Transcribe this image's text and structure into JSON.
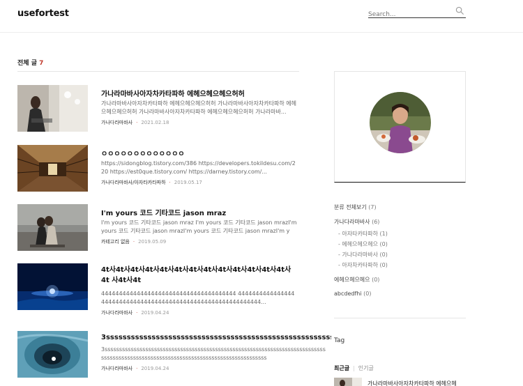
{
  "header": {
    "logo": "usefortest",
    "search_placeholder": "Search..."
  },
  "listing": {
    "label": "전체 글",
    "count": "7"
  },
  "posts": [
    {
      "title": "가나라마바사아자차카타파하 에헤으헤으헤으허허",
      "excerpt": "가나라마바사아자차카타파하 에헤으헤으헤으허허 가나라마바사아자차카타파하 에헤으헤으헤으허허 가나라마바사아자차카타파하 에헤으헤으헤으허허 가나라마바...",
      "category": "가나다라마바사",
      "date": "2021.02.18"
    },
    {
      "title": "ㅇㅇㅇㅇㅇㅇㅇㅇㅇㅇㅇㅇㅇ",
      "excerpt": "https://sidongblog.tistory.com/386 https://developers.tokildesu.com/220 https://est0que.tistory.com/ https://darney.tistory.com/...",
      "category": "가나다라마바사/아자타카타파하",
      "date": "2019.05.17"
    },
    {
      "title": "I'm yours 코드 기타코드 jason mraz",
      "excerpt": "I'm yours 코드 기타코드 jason mraz I'm yours 코드 기타코드 jason mrazI'm yours 코드 기타코드 jason mrazI'm yours 코드 기타코드 jason mrazI'm yo...",
      "category": "카테고리 없음",
      "date": "2019.05.09"
    },
    {
      "title": "4t사4t사4t사4t사4t사4t사4t사4t사4t사4t사4t사4t사4t사4t 사4t사4t",
      "excerpt": "44444444444444444444444444444444444444 4444444444444444444444444444444444444444444444444444444444444...",
      "category": "가나다라마바사",
      "date": "2019.04.24"
    },
    {
      "title": "3ssssssssssssssssssssssssssssssssssssssssssssssssssssssssssssss",
      "excerpt": "3sssssssssssssssssssssssssssssssssssssssssssssssssssssssssssssssssssssssssssssssssssssssssssssssssssssssssssssssssssssssssssssssssssss",
      "category": "가나다라마바사",
      "date": "2019.04.24"
    }
  ],
  "sidebar": {
    "categories": [
      {
        "label": "분류 전체보기",
        "count": "(7)",
        "sub": false
      },
      {
        "label": "가나다라마바사",
        "count": "(6)",
        "sub": false
      },
      {
        "label": "- 아자타카타파하",
        "count": "(1)",
        "sub": true
      },
      {
        "label": "- 에헤으헤으헤으",
        "count": "(0)",
        "sub": true
      },
      {
        "label": "- 가나다라마바사",
        "count": "(0)",
        "sub": true
      },
      {
        "label": "- 아자차카타파하",
        "count": "(0)",
        "sub": true
      },
      {
        "label": "에헤으헤으헤으",
        "count": "(0)",
        "sub": false
      },
      {
        "label": "abcdedfhi",
        "count": "(0)",
        "sub": false
      }
    ],
    "tag_title": "Tag",
    "tab_recent": "최근글",
    "tab_popular": "인기글",
    "recent_title": "가나라마바사아자차카타파하 에헤으헤"
  },
  "colors": {
    "accent": "#c0392b"
  }
}
